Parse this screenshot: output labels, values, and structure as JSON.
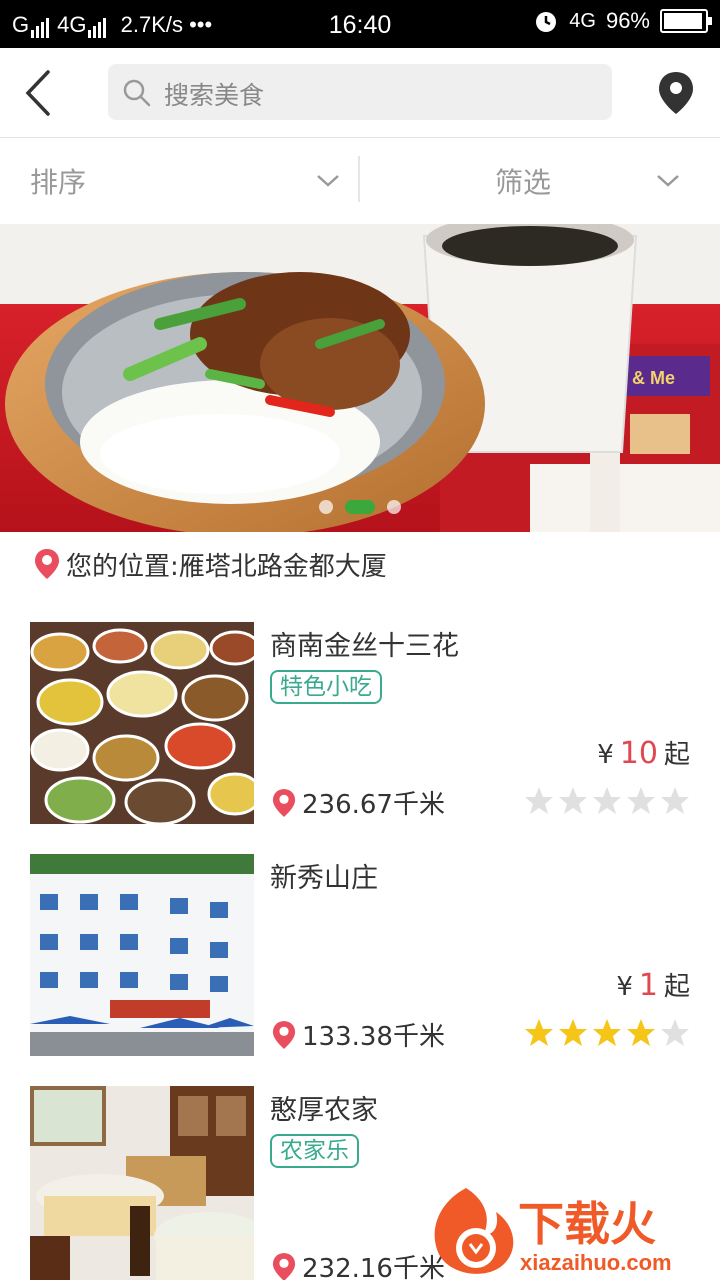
{
  "status_bar": {
    "carrier_left": "G",
    "network": "4G",
    "speed": "2.7K/s",
    "more": "•••",
    "time": "16:40",
    "network_right": "4G",
    "battery": "96%",
    "battery_level": 0.96
  },
  "nav": {
    "search_placeholder": "搜索美食"
  },
  "filters": {
    "sort_label": "排序",
    "filter_label": "筛选"
  },
  "banner": {
    "slide_count": 3,
    "active_index": 1,
    "sign_text": "& Me"
  },
  "location": {
    "text": "您的位置:雁塔北路金都大厦"
  },
  "restaurants": [
    {
      "name": "商南金丝十三花",
      "tag": "特色小吃",
      "price_prefix": "¥",
      "price": "10",
      "price_suffix": "起",
      "distance": "236.67千米",
      "rating": 0
    },
    {
      "name": "新秀山庄",
      "tag": "",
      "price_prefix": "¥",
      "price": "1",
      "price_suffix": "起",
      "distance": "133.38千米",
      "rating": 4
    },
    {
      "name": "憨厚农家",
      "tag": "农家乐",
      "price_prefix": "",
      "price": "",
      "price_suffix": "",
      "distance": "232.16千米",
      "rating": 0
    }
  ],
  "watermark": {
    "title": "下载火",
    "url": "xiazaihuo.com"
  },
  "colors": {
    "accent_green": "#3aa83a",
    "tag_green": "#3aaa8e",
    "price_red": "#e0474f",
    "pin_red": "#e94e5f",
    "star_yellow": "#f5c518",
    "star_gray": "#e0e0e0"
  }
}
